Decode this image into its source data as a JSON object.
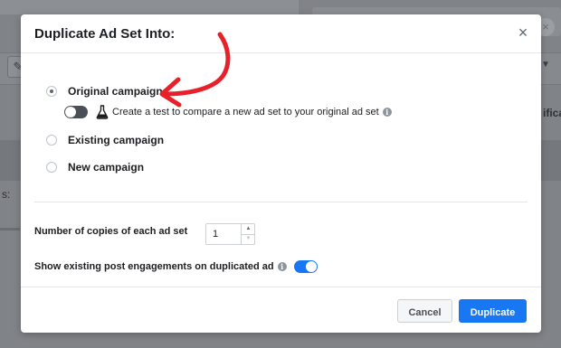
{
  "modal": {
    "title": "Duplicate Ad Set Into:",
    "close_label": "×",
    "options": [
      {
        "label": "Original campaign",
        "selected": true
      },
      {
        "label": "Existing campaign",
        "selected": false
      },
      {
        "label": "New campaign",
        "selected": false
      }
    ],
    "test": {
      "text": "Create a test to compare a new ad set to your original ad set",
      "toggle_on": false,
      "info_icon": "i"
    },
    "copies": {
      "label": "Number of copies of each ad set",
      "value": "1"
    },
    "engagements": {
      "label": "Show existing post engagements on duplicated ad",
      "info_icon": "i",
      "toggle_on": true
    },
    "footer": {
      "cancel_label": "Cancel",
      "duplicate_label": "Duplicate"
    }
  },
  "background": {
    "right_text": "ifica",
    "left_text": "s:"
  },
  "colors": {
    "primary": "#1877f2",
    "annotation": "#e8202a",
    "text": "#1c1e21",
    "overlay": "#808387"
  },
  "icons": {
    "close": "close-icon",
    "flask": "flask-icon",
    "info": "info-icon",
    "annotation": "red-arrow-annotation"
  }
}
